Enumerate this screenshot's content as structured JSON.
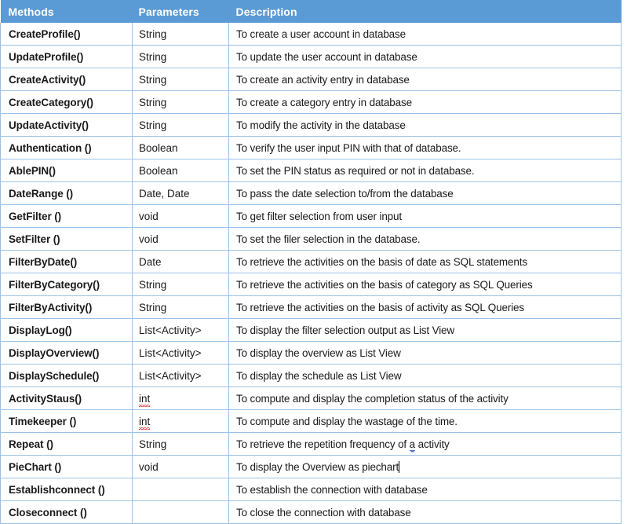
{
  "document": {
    "type": "table",
    "theme_accent_color": "#5B9BD5",
    "grid_line_color": "#9CC2E5",
    "caret_visible": true
  },
  "table": {
    "columns": [
      "Methods",
      "Parameters",
      "Description"
    ],
    "rows": [
      {
        "method": "CreateProfile()",
        "parameter": "String",
        "description": "To create a user account in database"
      },
      {
        "method": "UpdateProfile()",
        "parameter": "String",
        "description": "To update the user account in database"
      },
      {
        "method": "CreateActivity()",
        "parameter": "String",
        "description": "To create an activity entry in database"
      },
      {
        "method": "CreateCategory()",
        "parameter": "String",
        "description": "To create a category entry in database"
      },
      {
        "method": "UpdateActivity()",
        "parameter": "String",
        "description": "To modify the activity in the database"
      },
      {
        "method": "Authentication ()",
        "parameter": "Boolean",
        "description": "To verify the user input PIN with that of database."
      },
      {
        "method": "AblePIN()",
        "parameter": "Boolean",
        "description": "To set the PIN status as required or not in database."
      },
      {
        "method": "DateRange ()",
        "parameter": "Date, Date",
        "description": "To pass the date selection to/from the database"
      },
      {
        "method": "GetFilter ()",
        "parameter": "void",
        "description": "To get filter selection from user input"
      },
      {
        "method": "SetFilter ()",
        "parameter": "void",
        "description": "To set the filer selection in the database."
      },
      {
        "method": "FilterByDate()",
        "parameter": "Date",
        "description": "To retrieve the activities on the basis of date as SQL statements"
      },
      {
        "method": "FilterByCategory()",
        "parameter": "String",
        "description": "To retrieve the activities on the basis of category as SQL Queries"
      },
      {
        "method": "FilterByActivity()",
        "parameter": "String",
        "description": "To retrieve the activities on the basis of activity as SQL Queries"
      },
      {
        "method": "DisplayLog()",
        "parameter": "List<Activity>",
        "description": "To display the filter selection output as List View"
      },
      {
        "method": "DisplayOverview()",
        "parameter": "List<Activity>",
        "description": "To display the overview as List View"
      },
      {
        "method": "DisplaySchedule()",
        "parameter": "List<Activity>",
        "description": "To display the schedule as List View"
      },
      {
        "method": "ActivityStaus()",
        "parameter": "int",
        "parameter_spellcheck": true,
        "description": "To compute and display the completion status of the activity"
      },
      {
        "method": "Timekeeper ()",
        "parameter": "int",
        "parameter_spellcheck": true,
        "description": "To compute and display the wastage of the time."
      },
      {
        "method": "Repeat ()",
        "parameter": "String",
        "description_parts": [
          "To retrieve the repetition frequency of ",
          "a",
          " activity"
        ],
        "description_grammar_word": "a",
        "description": "To retrieve the repetition frequency of a activity"
      },
      {
        "method": "PieChart ()",
        "parameter": "void",
        "description": "To display the Overview as piechart",
        "caret_after_description": true
      },
      {
        "method": "Establishconnect ()",
        "parameter": "",
        "description": "To establish the connection with database"
      },
      {
        "method": "Closeconnect ()",
        "parameter": "",
        "description": "To close the connection with database"
      }
    ]
  }
}
